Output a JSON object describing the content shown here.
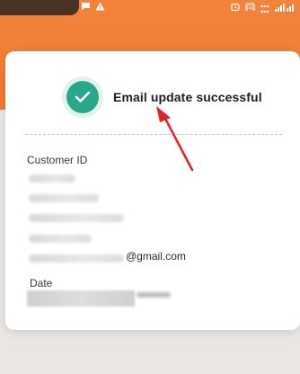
{
  "status_bar": {
    "left_icons": [
      "message-icon",
      "warning-icon"
    ],
    "right_icons": [
      "alarm-icon",
      "hotspot-icon",
      "network-speed-icon",
      "signal-icon"
    ]
  },
  "dialog": {
    "title": "Email update successful",
    "icon": "check-circle-icon",
    "accent_color": "#27a88b",
    "customer_id_label": "Customer ID",
    "email_suffix": "@gmail.com",
    "date_label": "Date"
  },
  "annotation": {
    "arrow_color": "#e2242a"
  }
}
